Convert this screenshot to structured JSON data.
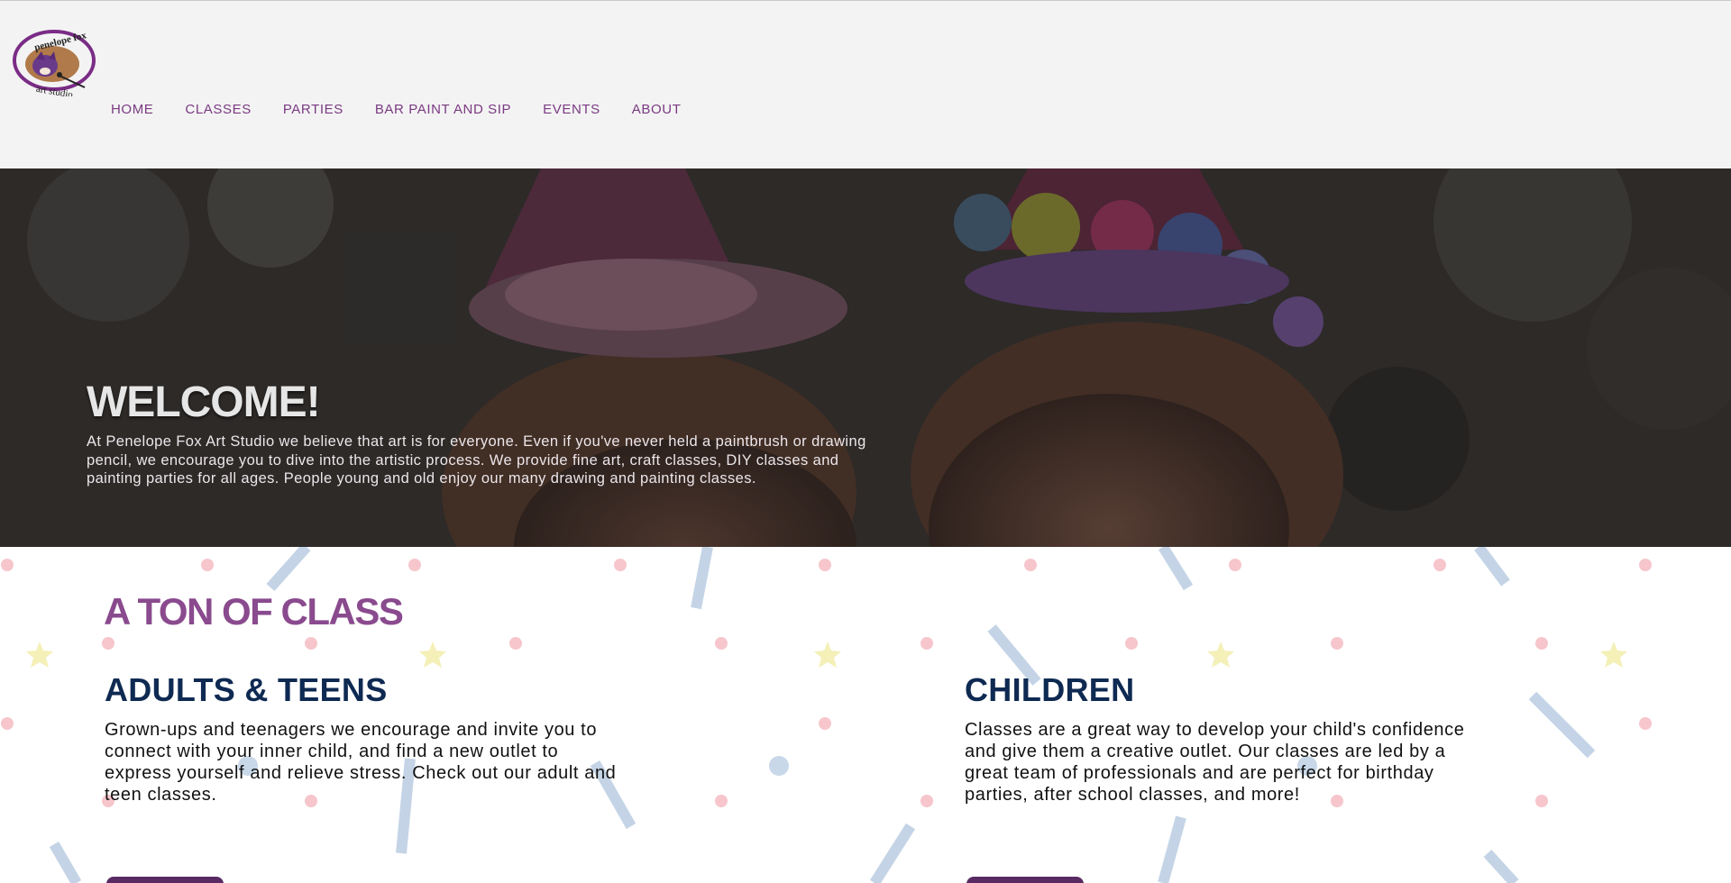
{
  "logo": {
    "line1": "penelope fox",
    "line2": "art studio"
  },
  "nav": {
    "items": [
      "HOME",
      "CLASSES",
      "PARTIES",
      "BAR PAINT AND SIP",
      "EVENTS",
      "ABOUT"
    ]
  },
  "hero": {
    "title": "WELCOME!",
    "text": "At Penelope Fox Art Studio we believe that art is for everyone. Even if you've never held a paintbrush or drawing pencil, we encourage you to dive into the artistic process. We provide fine art, craft classes, DIY classes and painting parties for all ages. People young and old enjoy our many drawing and painting classes."
  },
  "classes": {
    "title": "A TON OF CLASS",
    "adults": {
      "heading": "ADULTS & TEENS",
      "text": "Grown-ups and teenagers we encourage and invite you to connect with your inner child, and find a new outlet to express yourself and relieve stress. Check out our adult and teen classes."
    },
    "children": {
      "heading": "CHILDREN",
      "text": "Classes are a great way to develop your child's confidence and give them a creative outlet. Our classes are led by a great team of professionals and are perfect for birthday parties, after school classes, and more!"
    }
  },
  "colors": {
    "brand_purple": "#7a3a82",
    "heading_navy": "#0f2a52",
    "header_bg": "#f3f3f3"
  }
}
